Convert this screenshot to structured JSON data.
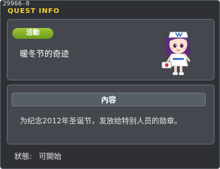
{
  "window": {
    "quest_id": "29966-0",
    "title": "QUEST INFO"
  },
  "quest": {
    "category_badge": "活動",
    "name": "暖冬节的奇迹",
    "npc_icon": "nurse-npc-character-icon"
  },
  "content": {
    "header": "內容",
    "description": "为纪念2012年圣诞节，发放给特别人员的勋章。"
  },
  "status": {
    "label": "狀態:",
    "value": "可開始"
  },
  "colors": {
    "title": "#f0d234",
    "badge": "#8ab52e",
    "background": "#2e3035",
    "panel": "#44474d"
  }
}
